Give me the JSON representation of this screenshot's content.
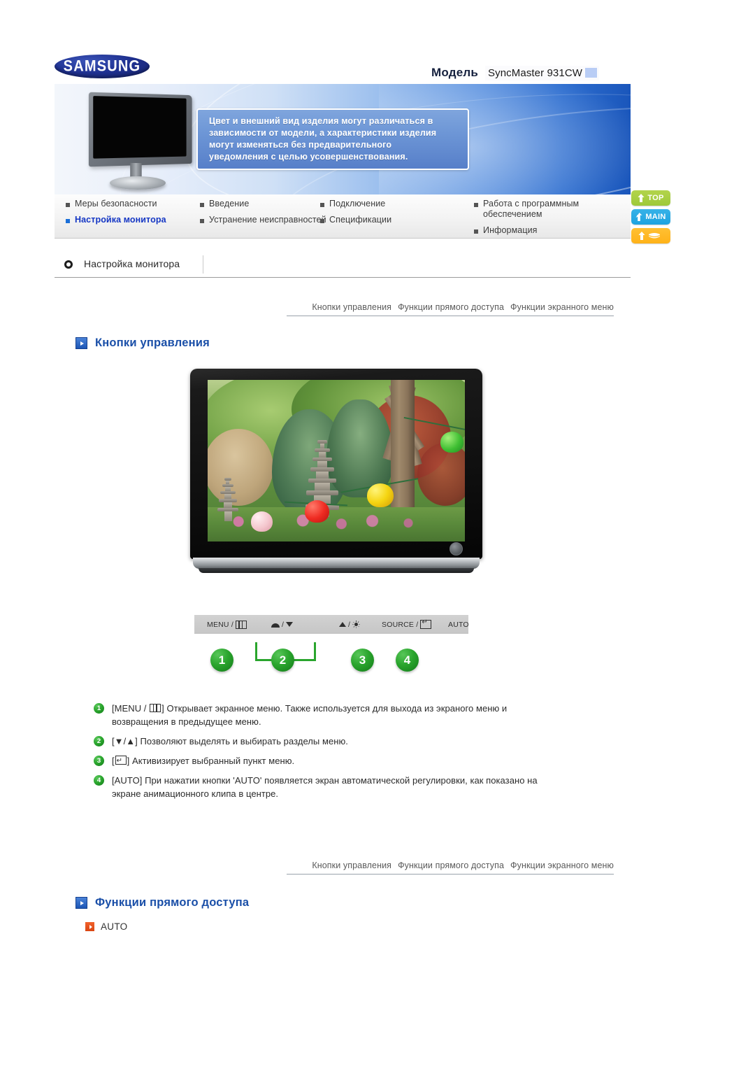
{
  "brand": {
    "logo_text": "SAMSUNG"
  },
  "model": {
    "label": "Модель",
    "value": "SyncMaster 931CW"
  },
  "banner": {
    "notice_line1": "Цвет и внешний вид изделия могут различаться в",
    "notice_line2": "зависимости от модели, а характеристики изделия",
    "notice_line3": "могут изменяться без предварительного",
    "notice_line4": "уведомления с целью усовершенствования."
  },
  "topnav": {
    "column1": [
      {
        "label": "Меры безопасности",
        "active": false
      },
      {
        "label": "Настройка монитора",
        "active": true
      }
    ],
    "column2": [
      {
        "label": "Введение",
        "active": false
      },
      {
        "label": "Устранение неисправностей",
        "active": false
      }
    ],
    "column3": [
      {
        "label": "Подключение",
        "active": false
      },
      {
        "label": "Спецификации",
        "active": false
      }
    ],
    "column4": [
      {
        "label": "Работа с программным обеспечением",
        "active": false
      },
      {
        "label": "Информация",
        "active": false
      }
    ]
  },
  "side_buttons": [
    {
      "label": "TOP",
      "color": "#a9ce44",
      "icon": "arrow-up-icon"
    },
    {
      "label": "MAIN",
      "color": "#26a8e2",
      "icon": "arrow-turn-icon"
    },
    {
      "label": "",
      "color": "#ffb719",
      "icon": "arrow-up-book-icon"
    }
  ],
  "section": {
    "title": "Настройка монитора"
  },
  "subnav": {
    "links": [
      "Кнопки управления",
      "Функции прямого доступа",
      "Функции экранного меню"
    ]
  },
  "headings": {
    "controls": "Кнопки управления",
    "direct": "Функции прямого доступа"
  },
  "control_strip": {
    "menu": "MENU /",
    "down": "/",
    "up": "/",
    "source": "SOURCE /",
    "auto": "AUTO"
  },
  "callouts": [
    "1",
    "2",
    "3",
    "4"
  ],
  "descriptions": [
    {
      "num": "1",
      "pre": "[MENU / ",
      "post": "] Открывает экранное меню. Также используется для выхода из экраного меню и возвращения в предыдущее меню."
    },
    {
      "num": "2",
      "pre": "[▼/▲] ",
      "post": "Позволяют выделять и выбирать разделы меню."
    },
    {
      "num": "3",
      "pre": "[",
      "post": "] Активизирует выбранный пункт меню."
    },
    {
      "num": "4",
      "pre": "[AUTO] ",
      "post": "При нажатии кнопки 'AUTO' появляется экран автоматической регулировки, как показано на экране анимационного клипа в центре."
    }
  ],
  "direct_access": {
    "auto_label": "AUTO"
  },
  "colors": {
    "heading_blue": "#1a4fa8",
    "active_nav": "#1436c4",
    "callout_green": "#2aa52d",
    "auto_orange": "#e04f16",
    "banner_blue": "#1a56bb"
  }
}
